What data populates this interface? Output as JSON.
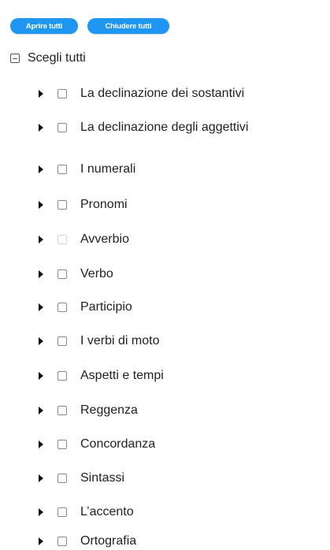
{
  "toolbar": {
    "open_all_label": "Aprire tutti",
    "close_all_label": "Chiudere tutti"
  },
  "tree": {
    "root_label": "Scegli tutti",
    "items": [
      {
        "label": "La declinazione dei sostantivi"
      },
      {
        "label": "La declinazione degli aggettivi"
      },
      {
        "label": "I numerali"
      },
      {
        "label": "Pronomi"
      },
      {
        "label": "Avverbio"
      },
      {
        "label": "Verbo"
      },
      {
        "label": "Participio"
      },
      {
        "label": "I verbi di moto"
      },
      {
        "label": "Aspetti e tempi"
      },
      {
        "label": "Reggenza"
      },
      {
        "label": "Concordanza"
      },
      {
        "label": "Sintassi"
      },
      {
        "label": "L’accento"
      },
      {
        "label": "Ortografia"
      }
    ]
  },
  "colors": {
    "button_background": "#1e97f3",
    "button_text": "#ffffff",
    "text": "#222222"
  }
}
